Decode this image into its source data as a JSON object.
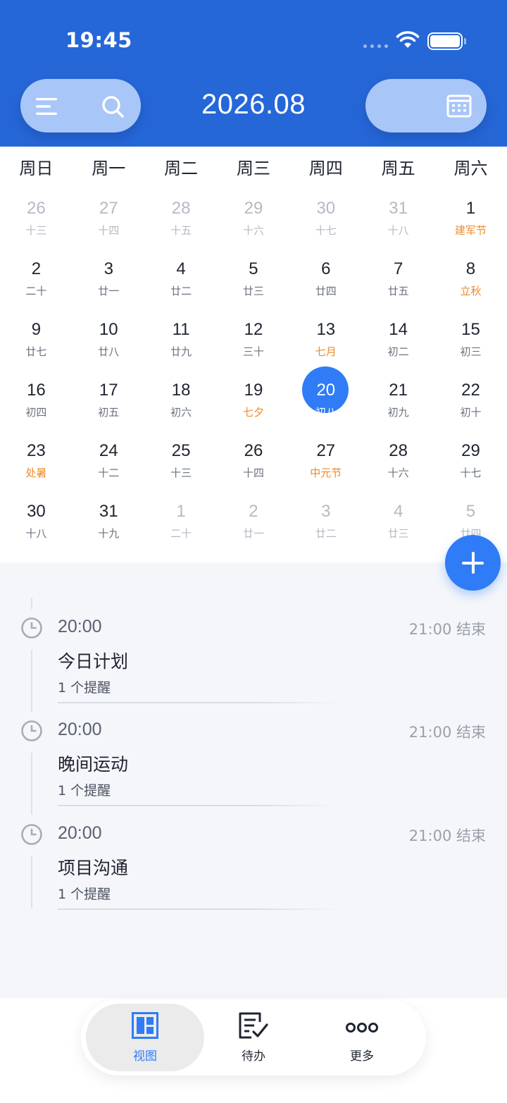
{
  "status_bar": {
    "time": "19:45"
  },
  "header": {
    "title": "2026.08",
    "menu_icon": "menu-icon",
    "search_icon": "search-icon",
    "calendar_icon": "calendar-icon"
  },
  "weekdays": [
    "周日",
    "周一",
    "周二",
    "周三",
    "周四",
    "周五",
    "周六"
  ],
  "weeks": [
    [
      {
        "d": "26",
        "s": "十三",
        "other": true
      },
      {
        "d": "27",
        "s": "十四",
        "other": true
      },
      {
        "d": "28",
        "s": "十五",
        "other": true
      },
      {
        "d": "29",
        "s": "十六",
        "other": true
      },
      {
        "d": "30",
        "s": "十七",
        "other": true
      },
      {
        "d": "31",
        "s": "十八",
        "other": true
      },
      {
        "d": "1",
        "s": "建军节",
        "holiday": true
      }
    ],
    [
      {
        "d": "2",
        "s": "二十"
      },
      {
        "d": "3",
        "s": "廿一"
      },
      {
        "d": "4",
        "s": "廿二"
      },
      {
        "d": "5",
        "s": "廿三"
      },
      {
        "d": "6",
        "s": "廿四"
      },
      {
        "d": "7",
        "s": "廿五"
      },
      {
        "d": "8",
        "s": "立秋",
        "holiday": true
      }
    ],
    [
      {
        "d": "9",
        "s": "廿七"
      },
      {
        "d": "10",
        "s": "廿八"
      },
      {
        "d": "11",
        "s": "廿九"
      },
      {
        "d": "12",
        "s": "三十"
      },
      {
        "d": "13",
        "s": "七月",
        "holiday": true
      },
      {
        "d": "14",
        "s": "初二"
      },
      {
        "d": "15",
        "s": "初三"
      }
    ],
    [
      {
        "d": "16",
        "s": "初四"
      },
      {
        "d": "17",
        "s": "初五"
      },
      {
        "d": "18",
        "s": "初六"
      },
      {
        "d": "19",
        "s": "七夕",
        "holiday": true
      },
      {
        "d": "20",
        "s": "初八",
        "selected": true
      },
      {
        "d": "21",
        "s": "初九"
      },
      {
        "d": "22",
        "s": "初十"
      }
    ],
    [
      {
        "d": "23",
        "s": "处暑",
        "holiday": true
      },
      {
        "d": "24",
        "s": "十二"
      },
      {
        "d": "25",
        "s": "十三"
      },
      {
        "d": "26",
        "s": "十四"
      },
      {
        "d": "27",
        "s": "中元节",
        "holiday": true
      },
      {
        "d": "28",
        "s": "十六"
      },
      {
        "d": "29",
        "s": "十七"
      }
    ],
    [
      {
        "d": "30",
        "s": "十八"
      },
      {
        "d": "31",
        "s": "十九"
      },
      {
        "d": "1",
        "s": "二十",
        "other": true
      },
      {
        "d": "2",
        "s": "廿一",
        "other": true
      },
      {
        "d": "3",
        "s": "廿二",
        "other": true
      },
      {
        "d": "4",
        "s": "廿三",
        "other": true
      },
      {
        "d": "5",
        "s": "廿四",
        "other": true
      }
    ]
  ],
  "events": [
    {
      "time": "20:00",
      "end": "21:00 结束",
      "title": "今日计划",
      "reminder": "1 个提醒"
    },
    {
      "time": "20:00",
      "end": "21:00 结束",
      "title": "晚间运动",
      "reminder": "1 个提醒"
    },
    {
      "time": "20:00",
      "end": "21:00 结束",
      "title": "项目沟通",
      "reminder": "1 个提醒"
    }
  ],
  "nav": {
    "items": [
      {
        "label": "视图",
        "icon": "view-grid-icon",
        "active": true
      },
      {
        "label": "待办",
        "icon": "todo-icon",
        "active": false
      },
      {
        "label": "更多",
        "icon": "more-icon",
        "active": false
      }
    ]
  },
  "colors": {
    "header": "#2667d8",
    "accent": "#2f7cf6",
    "holiday": "#f08a2a",
    "muted": "#b4bac4"
  }
}
